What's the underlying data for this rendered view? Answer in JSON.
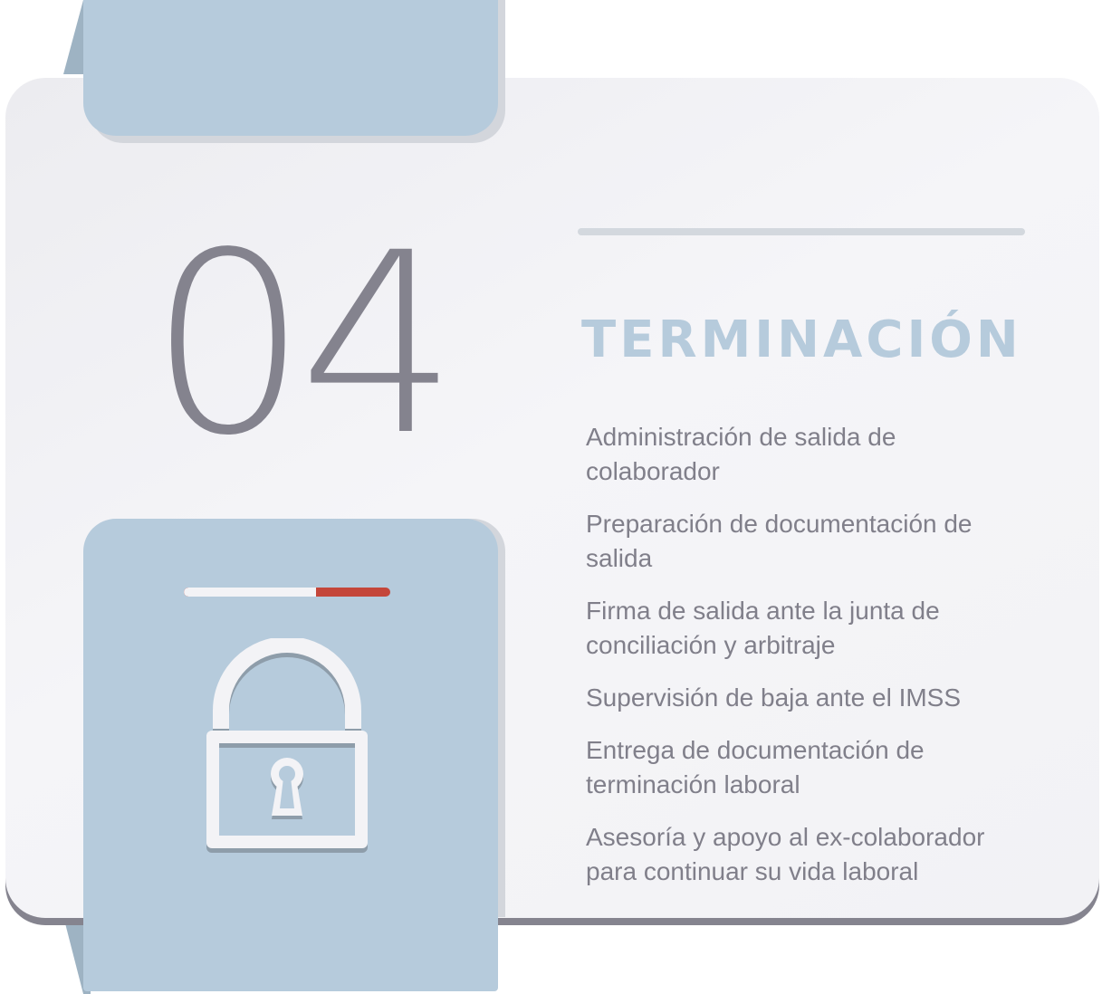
{
  "card": {
    "number": "04",
    "title": "TERMINACIÓN",
    "items": [
      "Administración de salida de\ncolaborador",
      "Preparación de documentación de\nsalida",
      "Firma de salida ante la junta de\nconciliación y arbitraje",
      "Supervisión de baja ante el IMSS",
      "Entrega de documentación de\nterminación laboral",
      "Asesoría y apoyo al ex-colaborador\npara continuar su vida laboral"
    ]
  },
  "progress": {
    "fraction": 0.64
  },
  "icon": "padlock-icon",
  "colors": {
    "accent_blue": "#b6cbdc",
    "number_gray": "#84838e",
    "text_gray": "#807f8a",
    "progress_red": "#c4463a",
    "card_bg": "#f3f3f6"
  }
}
